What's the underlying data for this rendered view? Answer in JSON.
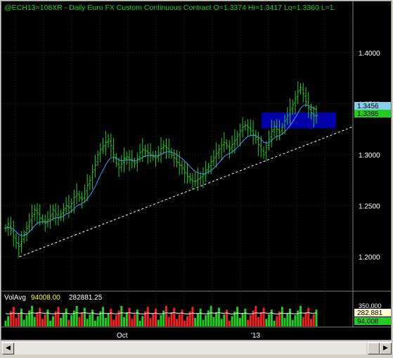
{
  "window": {
    "header": {
      "symbol": "@ECH13=108XR",
      "interval": "Daily",
      "description": "Euro FX Custom Continuous Contract",
      "open": "O=1.3374",
      "high": "Hi=1.3417",
      "low": "Lo=1.3360",
      "last": "L=1."
    },
    "price_axis": [
      "1.4000",
      "1.3500",
      "1.3000",
      "1.2500",
      "1.2000"
    ],
    "price_markers": {
      "average": "1.3456",
      "last": "1.3385"
    },
    "volume_panel": {
      "label": "VolAvg",
      "value1": "94008.00",
      "value2": "282881.25",
      "axis_top": "350,000",
      "marker_avg": "282,881",
      "marker_last": "94,008"
    },
    "time_axis": [
      "Oct",
      "'13"
    ],
    "scrollbar": {
      "left_arrow": "◀",
      "right_arrow": "▶"
    }
  },
  "chart_data": {
    "type": "bar",
    "title": "@ECH13=108XR - Daily  Euro FX Custom Continuous Contract",
    "ylim": [
      1.17,
      1.43
    ],
    "y_ticks": [
      1.2,
      1.25,
      1.3,
      1.35,
      1.4
    ],
    "x_ticks": [
      "Oct",
      "'13"
    ],
    "grid": true,
    "ohlc_closes": [
      1.228,
      1.232,
      1.226,
      1.22,
      1.214,
      1.21,
      1.215,
      1.222,
      1.228,
      1.234,
      1.24,
      1.246,
      1.243,
      1.238,
      1.236,
      1.233,
      1.236,
      1.24,
      1.246,
      1.242,
      1.238,
      1.242,
      1.246,
      1.25,
      1.248,
      1.252,
      1.258,
      1.262,
      1.258,
      1.256,
      1.262,
      1.27,
      1.275,
      1.283,
      1.29,
      1.3,
      1.305,
      1.308,
      1.312,
      1.315,
      1.309,
      1.3,
      1.292,
      1.287,
      1.291,
      1.296,
      1.298,
      1.295,
      1.294,
      1.291,
      1.296,
      1.302,
      1.305,
      1.304,
      1.302,
      1.3,
      1.298,
      1.297,
      1.3,
      1.306,
      1.309,
      1.307,
      1.304,
      1.3,
      1.297,
      1.293,
      1.29,
      1.287,
      1.283,
      1.279,
      1.276,
      1.274,
      1.274,
      1.276,
      1.278,
      1.28,
      1.284,
      1.288,
      1.293,
      1.296,
      1.301,
      1.305,
      1.309,
      1.312,
      1.309,
      1.305,
      1.31,
      1.314,
      1.318,
      1.323,
      1.327,
      1.329,
      1.327,
      1.324,
      1.32,
      1.317,
      1.31,
      1.305,
      1.3,
      1.307,
      1.315,
      1.323,
      1.328,
      1.325,
      1.322,
      1.327,
      1.333,
      1.338,
      1.344,
      1.349,
      1.355,
      1.362,
      1.366,
      1.36,
      1.352,
      1.346,
      1.341,
      1.338,
      1.3385
    ],
    "moving_average_last": 1.3456,
    "volume": {
      "ylim": [
        0,
        350000
      ],
      "avg_last": 282881.25,
      "last": 94008
    }
  }
}
